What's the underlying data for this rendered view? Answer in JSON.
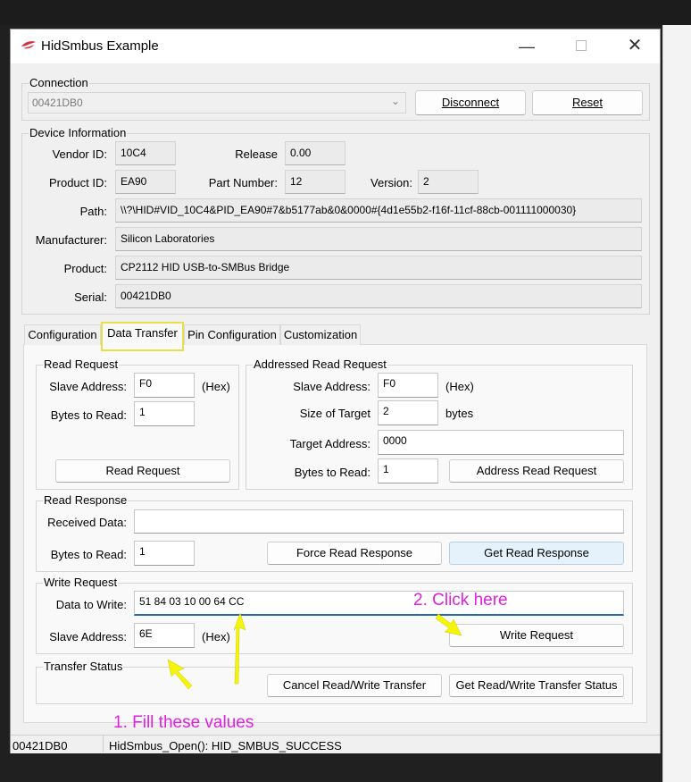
{
  "window": {
    "title": "HidSmbus Example"
  },
  "connection": {
    "label": "Connection",
    "device": "00421DB0",
    "disconnect": "Disconnect",
    "reset": "Reset"
  },
  "device_info": {
    "label": "Device Information",
    "vendor_id_label": "Vendor ID:",
    "vendor_id": "10C4",
    "release_label": "Release",
    "release": "0.00",
    "product_id_label": "Product ID:",
    "product_id": "EA90",
    "part_number_label": "Part Number:",
    "part_number": "12",
    "version_label": "Version:",
    "version": "2",
    "path_label": "Path:",
    "path": "\\\\?\\HID#VID_10C4&PID_EA90#7&b5177ab&0&0000#{4d1e55b2-f16f-11cf-88cb-001111000030}",
    "manufacturer_label": "Manufacturer:",
    "manufacturer": "Silicon Laboratories",
    "product_label": "Product:",
    "product": "CP2112 HID USB-to-SMBus Bridge",
    "serial_label": "Serial:",
    "serial": "00421DB0"
  },
  "tabs": [
    "Configuration",
    "Data Transfer",
    "Pin Configuration",
    "Customization"
  ],
  "read_request": {
    "label": "Read Request",
    "slave_label": "Slave Address:",
    "slave": "F0",
    "hex": "(Hex)",
    "bytes_label": "Bytes to Read:",
    "bytes": "1",
    "button": "Read Request"
  },
  "addressed_read": {
    "label": "Addressed Read Request",
    "slave_label": "Slave Address:",
    "slave": "F0",
    "hex": "(Hex)",
    "size_label": "Size of Target",
    "size": "2",
    "bytes_unit": "bytes",
    "target_label": "Target Address:",
    "target": "0000",
    "bytes_label": "Bytes to Read:",
    "bytes": "1",
    "button": "Address Read Request"
  },
  "read_response": {
    "label": "Read Response",
    "received_label": "Received Data:",
    "received": "",
    "bytes_label": "Bytes to Read:",
    "bytes": "1",
    "force_button": "Force Read Response",
    "get_button": "Get Read Response"
  },
  "write_request": {
    "label": "Write Request",
    "data_label": "Data to Write:",
    "data": "51 84 03 10 00 64 CC",
    "slave_label": "Slave Address:",
    "slave": "6E",
    "hex": "(Hex)",
    "button": "Write Request"
  },
  "transfer_status": {
    "label": "Transfer Status",
    "cancel_button": "Cancel Read/Write Transfer",
    "get_button": "Get Read/Write Transfer Status"
  },
  "annotations": {
    "fill": "1. Fill these values",
    "click": "2. Click here",
    "arrow_color": "#f5f50a",
    "text_color": "#e020e0"
  },
  "status_bar": {
    "device": "00421DB0",
    "message": "HidSmbus_Open(): HID_SMBUS_SUCCESS"
  }
}
